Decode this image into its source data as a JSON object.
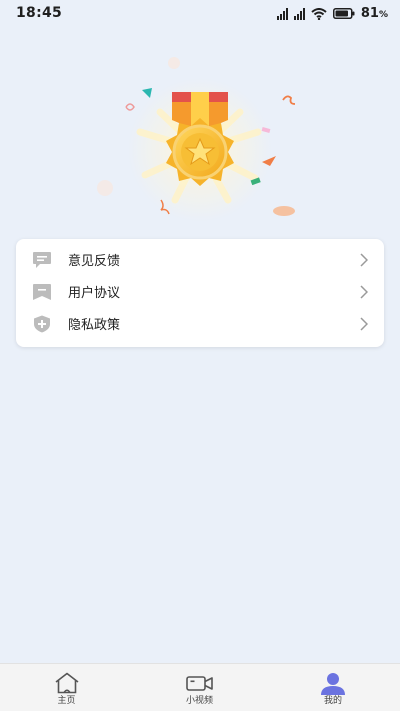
{
  "status_bar": {
    "time": "18:45",
    "battery_percent": "81",
    "battery_unit": "%"
  },
  "menu": {
    "items": [
      {
        "label": "意见反馈",
        "icon": "feedback-icon"
      },
      {
        "label": "用户协议",
        "icon": "agreement-icon"
      },
      {
        "label": "隐私政策",
        "icon": "privacy-shield-icon"
      }
    ]
  },
  "tabbar": {
    "tabs": [
      {
        "label": "主页",
        "icon": "home-icon",
        "active": false
      },
      {
        "label": "小视频",
        "icon": "video-camera-icon",
        "active": false
      },
      {
        "label": "我的",
        "icon": "profile-icon",
        "active": true
      }
    ]
  },
  "colors": {
    "background": "#eaf0f9",
    "active_tab": "#6b73e0",
    "icon_gray": "#bcbcbc"
  }
}
